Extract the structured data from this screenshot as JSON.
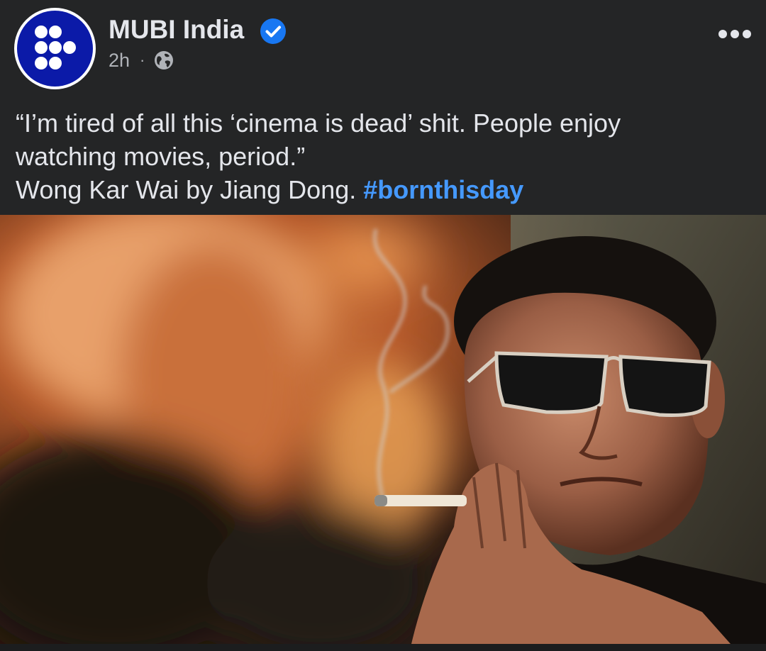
{
  "post": {
    "author": "MUBI India",
    "verified": true,
    "time": "2h",
    "separator": "·",
    "audience_icon": "globe-icon",
    "more_icon": "more-horizontal-icon",
    "text_lines": [
      "“I’m tired of all this ‘cinema is dead’ shit. People enjoy",
      "watching movies, period.”",
      "Wong Kar Wai by Jiang Dong. "
    ],
    "hashtag": "#bornthisday",
    "photo_icon": "post-photo"
  },
  "colors": {
    "background": "#242526",
    "text": "#e4e6eb",
    "secondary_text": "#b0b3b8",
    "link": "#4599ff",
    "verified_badge": "#1877f2",
    "mubi_blue": "#0b1aa8"
  }
}
